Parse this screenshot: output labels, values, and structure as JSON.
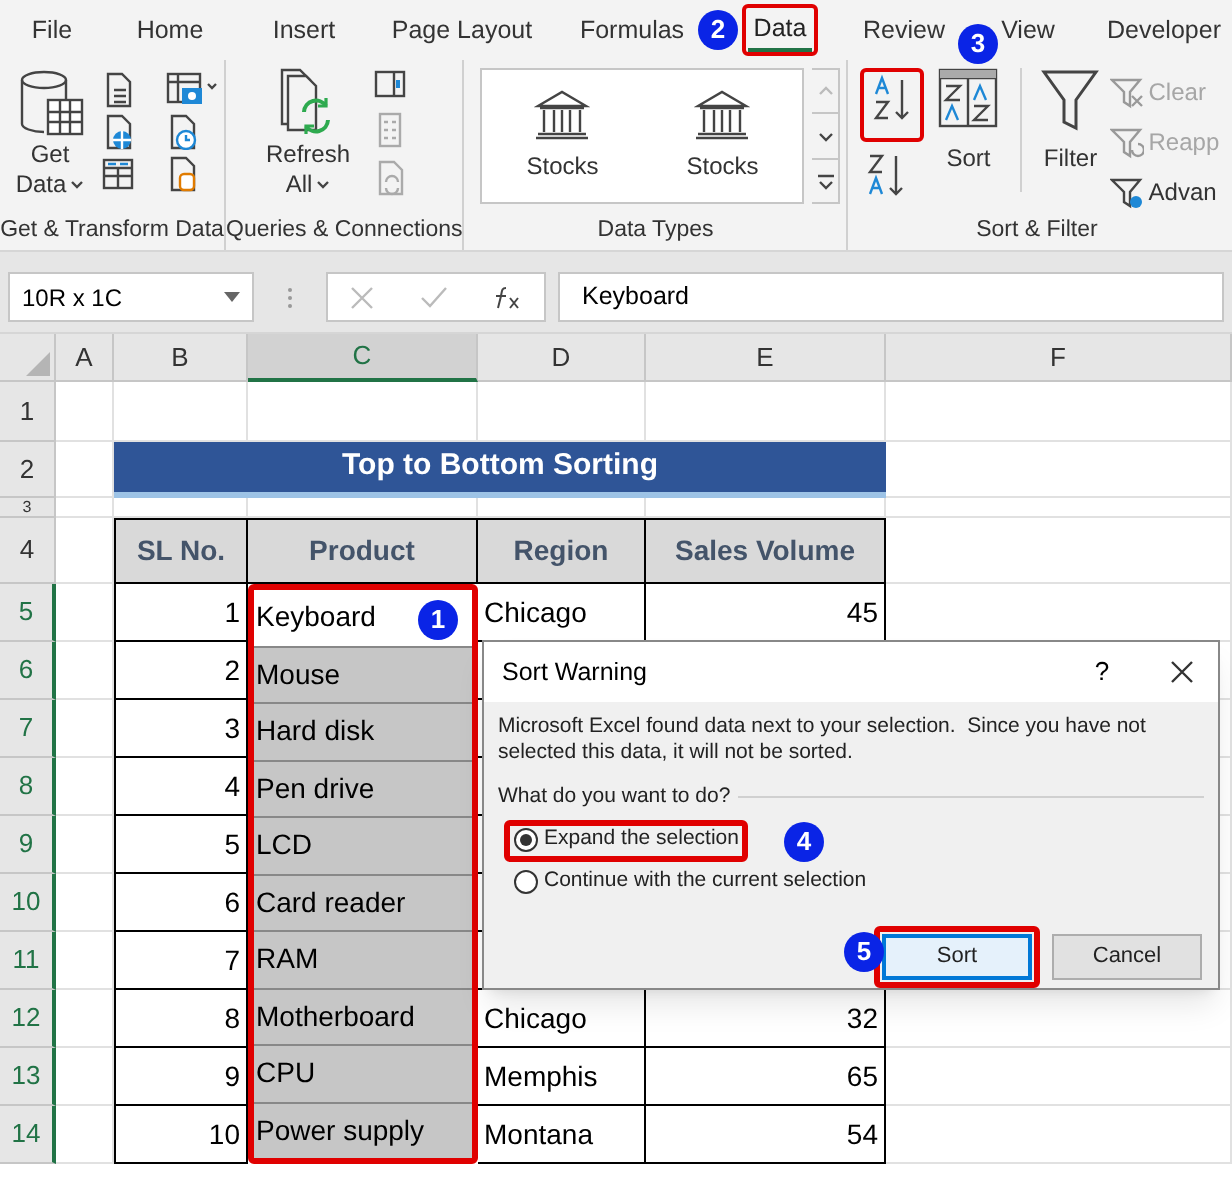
{
  "menu_tabs": [
    {
      "label": "File",
      "selected": false,
      "highlighted": false
    },
    {
      "label": "Home",
      "selected": false,
      "highlighted": false
    },
    {
      "label": "Insert",
      "selected": false,
      "highlighted": false
    },
    {
      "label": "Page Layout",
      "selected": false,
      "highlighted": false
    },
    {
      "label": "Formulas",
      "selected": false,
      "highlighted": false
    },
    {
      "label": "Data",
      "selected": true,
      "highlighted": true
    },
    {
      "label": "Review",
      "selected": false,
      "highlighted": false
    },
    {
      "label": "View",
      "selected": false,
      "highlighted": false
    },
    {
      "label": "Developer",
      "selected": false,
      "highlighted": false
    }
  ],
  "ribbon": {
    "get_data": {
      "line1": "Get",
      "line2": "Data"
    },
    "refresh": {
      "line1": "Refresh",
      "line2": "All"
    },
    "data_types": [
      "Stocks",
      "Stocks"
    ],
    "sort": "Sort",
    "filter": "Filter",
    "filter_options": [
      {
        "label": "Clear",
        "disabled": true
      },
      {
        "label": "Reapp",
        "disabled": true
      },
      {
        "label": "Advan",
        "disabled": false
      }
    ],
    "groups": [
      "Get & Transform Data",
      "Queries & Connections",
      "Data Types",
      "Sort & Filter"
    ]
  },
  "name_box": "10R x 1C",
  "formula": "Keyboard",
  "columns": [
    {
      "label": "A",
      "selected": false
    },
    {
      "label": "B",
      "selected": false
    },
    {
      "label": "C",
      "selected": true
    },
    {
      "label": "D",
      "selected": false
    },
    {
      "label": "E",
      "selected": false
    },
    {
      "label": "F",
      "selected": false
    }
  ],
  "row_headers": [
    {
      "label": "1",
      "selected": false
    },
    {
      "label": "2",
      "selected": false
    },
    {
      "label": "3",
      "selected": false
    },
    {
      "label": "4",
      "selected": false
    },
    {
      "label": "5",
      "selected": true
    },
    {
      "label": "6",
      "selected": true
    },
    {
      "label": "7",
      "selected": true
    },
    {
      "label": "8",
      "selected": true
    },
    {
      "label": "9",
      "selected": true
    },
    {
      "label": "10",
      "selected": true
    },
    {
      "label": "11",
      "selected": true
    },
    {
      "label": "12",
      "selected": true
    },
    {
      "label": "13",
      "selected": true
    },
    {
      "label": "14",
      "selected": true
    }
  ],
  "sheet_title": "Top to Bottom Sorting",
  "table": {
    "columns": [
      "SL No.",
      "Product",
      "Region",
      "Sales Volume"
    ],
    "rows": [
      {
        "sl": "1",
        "product": "Keyboard",
        "region": "Chicago",
        "sales": "45",
        "active": true
      },
      {
        "sl": "2",
        "product": "Mouse",
        "active": false
      },
      {
        "sl": "3",
        "product": "Hard disk",
        "active": false
      },
      {
        "sl": "4",
        "product": "Pen drive",
        "active": false
      },
      {
        "sl": "5",
        "product": "LCD",
        "active": false
      },
      {
        "sl": "6",
        "product": "Card reader",
        "active": false
      },
      {
        "sl": "7",
        "product": "RAM",
        "active": false
      },
      {
        "sl": "8",
        "product": "Motherboard",
        "region": "Chicago",
        "sales": "32",
        "active": false
      },
      {
        "sl": "9",
        "product": "CPU",
        "region": "Memphis",
        "sales": "65",
        "active": false
      },
      {
        "sl": "10",
        "product": "Power supply",
        "region": "Montana",
        "sales": "54",
        "active": false
      }
    ]
  },
  "dialog": {
    "title": "Sort Warning",
    "help": "?",
    "message": "Microsoft Excel found data next to your selection.  Since you have not selected this data, it will not be sorted.",
    "question": "What do you want to do?",
    "options": [
      {
        "label": "Expand the selection",
        "selected": true,
        "highlighted": true
      },
      {
        "label": "Continue with the current selection",
        "selected": false,
        "highlighted": false
      }
    ],
    "buttons": [
      {
        "label": "Sort",
        "default": true,
        "highlighted": true
      },
      {
        "label": "Cancel",
        "default": false,
        "highlighted": false
      }
    ]
  },
  "steps": [
    "1",
    "2",
    "3",
    "4",
    "5"
  ]
}
